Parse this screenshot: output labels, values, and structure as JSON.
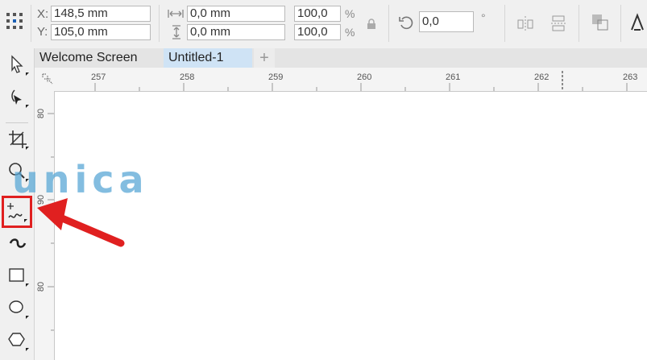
{
  "propbar": {
    "x_label": "X:",
    "x_value": "148,5 mm",
    "y_label": "Y:",
    "y_value": "105,0 mm",
    "w_value": "0,0 mm",
    "h_value": "0,0 mm",
    "scale_x": "100,0",
    "scale_y": "100,0",
    "percent": "%",
    "rotation": "0,0",
    "degree": "°"
  },
  "tabs": [
    {
      "label": "Welcome Screen"
    },
    {
      "label": "Untitled-1"
    },
    {
      "label": "+"
    }
  ],
  "ruler": {
    "h_ticks": [
      "257",
      "258",
      "259",
      "260",
      "261",
      "262",
      "263"
    ],
    "v_ticks": [
      "80",
      "90",
      "80"
    ]
  },
  "watermark": "unica",
  "colors": {
    "highlight": "#e02020",
    "active_tab": "#cfe3f5",
    "watermark": "#5aa8d6"
  }
}
